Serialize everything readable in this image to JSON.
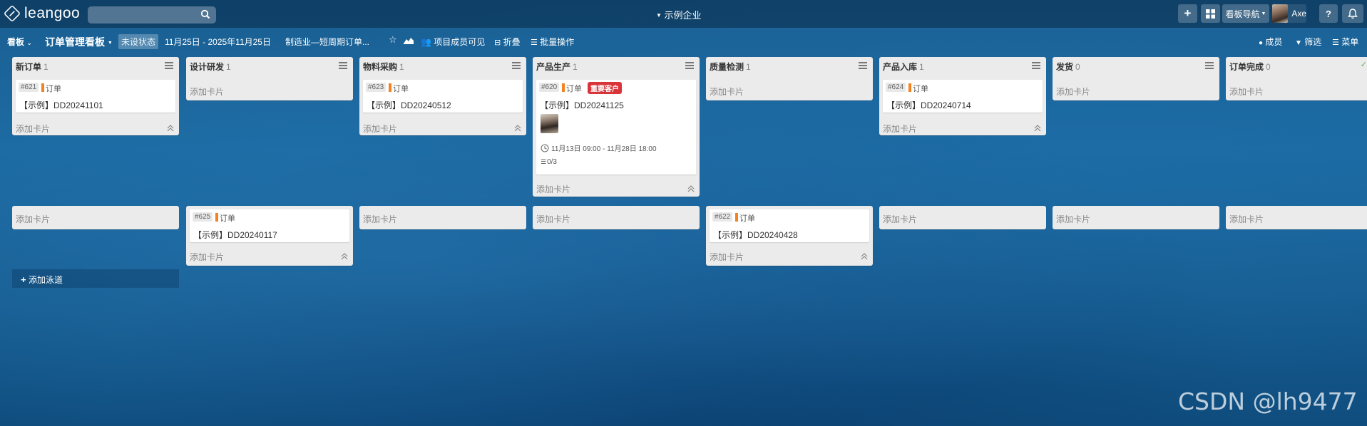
{
  "topbar": {
    "logo_text": "leangoo",
    "search_placeholder": "",
    "company": "示例企业",
    "board_nav": "看板导航",
    "user_name": "Axe",
    "help": "?"
  },
  "boardbar": {
    "view_menu": "看板",
    "board_title": "订单管理看板",
    "status": "未设状态",
    "date_range": "11月25日 - 2025年11月25日",
    "description": "制造业—短周期订单...",
    "visibility": "项目成员可见",
    "fold": "折叠",
    "batch": "批量操作",
    "members": "成员",
    "filter": "筛选",
    "menu": "菜单"
  },
  "add_card_label": "添加卡片",
  "add_swimlane_label": "添加泳道",
  "lists": [
    {
      "title": "新订单",
      "count": "1"
    },
    {
      "title": "设计研发",
      "count": "1"
    },
    {
      "title": "物料采购",
      "count": "1"
    },
    {
      "title": "产品生产",
      "count": "1"
    },
    {
      "title": "质量检测",
      "count": "1"
    },
    {
      "title": "产品入库",
      "count": "1"
    },
    {
      "title": "发货",
      "count": "0"
    },
    {
      "title": "订单完成",
      "count": "0"
    }
  ],
  "cards": {
    "c621": {
      "id": "#621",
      "tag": "订单",
      "title": "【示例】DD20241101"
    },
    "c623": {
      "id": "#623",
      "tag": "订单",
      "title": "【示例】DD20240512"
    },
    "c620": {
      "id": "#620",
      "tag": "订单",
      "badge": "重要客户",
      "title": "【示例】DD20241125",
      "due": "11月13日 09:00 - 11月28日 18:00",
      "checklist": "0/3"
    },
    "c624": {
      "id": "#624",
      "tag": "订单",
      "title": "【示例】DD20240714"
    },
    "c625": {
      "id": "#625",
      "tag": "订单",
      "title": "【示例】DD20240117"
    },
    "c622": {
      "id": "#622",
      "tag": "订单",
      "title": "【示例】DD20240428"
    }
  },
  "colors": {
    "tag": "#f5821f",
    "vip_badge": "#d9343a"
  },
  "watermark": "CSDN @lh9477"
}
